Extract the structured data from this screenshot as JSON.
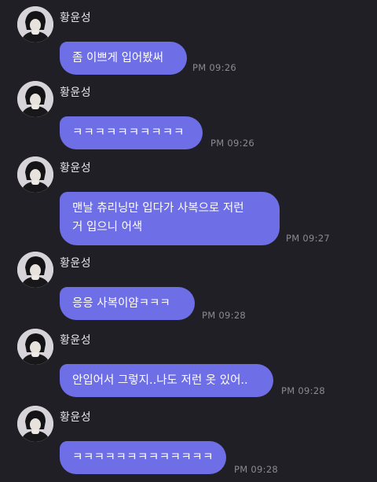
{
  "messages": [
    {
      "sender": "황윤성",
      "text": "좀 이쁘게 입어봤써",
      "time": "PM 09:26"
    },
    {
      "sender": "황윤성",
      "text": "ㅋㅋㅋㅋㅋㅋㅋㅋㅋㅋ",
      "time": "PM 09:26"
    },
    {
      "sender": "황윤성",
      "text": "맨날 츄리닝만 입다가 사복으로 저런\n거 입으니 어색",
      "time": "PM 09:27"
    },
    {
      "sender": "황윤성",
      "text": "응응 사복이얌ㅋㅋㅋ",
      "time": "PM 09:28"
    },
    {
      "sender": "황윤성",
      "text": "안입어서 그렇지..나도 저런 옷 있어..",
      "time": "PM 09:28"
    },
    {
      "sender": "황윤성",
      "text": "ㅋㅋㅋㅋㅋㅋㅋㅋㅋㅋㅋㅋㅋ",
      "time": "PM 09:28"
    }
  ],
  "colors": {
    "background": "#1f1f25",
    "bubble": "#6e6ee6",
    "sender_text": "#e6e6ea",
    "time_text": "#8a8a90"
  }
}
